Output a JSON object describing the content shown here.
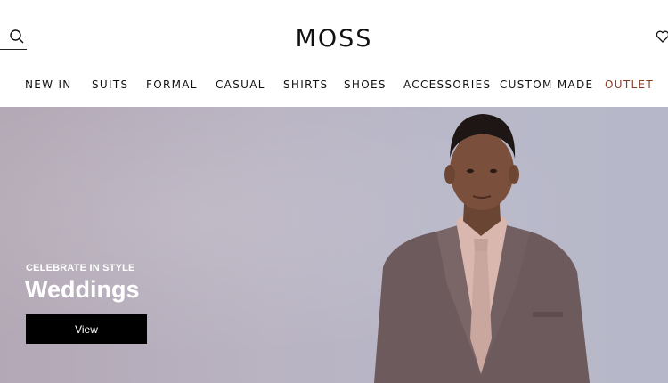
{
  "header": {
    "logo": "MOSS",
    "search_icon": "search-icon",
    "wishlist_icon": "heart-icon"
  },
  "nav": {
    "items": [
      {
        "label": "NEW IN"
      },
      {
        "label": "SUITS"
      },
      {
        "label": "FORMAL"
      },
      {
        "label": "CASUAL"
      },
      {
        "label": "SHIRTS"
      },
      {
        "label": "SHOES"
      },
      {
        "label": "ACCESSORIES"
      },
      {
        "label": "CUSTOM MADE"
      },
      {
        "label": "OUTLET"
      }
    ],
    "outlet_color": "#8a3b24"
  },
  "hero": {
    "eyebrow": "CELEBRATE IN STYLE",
    "title": "Weddings",
    "cta_label": "View"
  }
}
